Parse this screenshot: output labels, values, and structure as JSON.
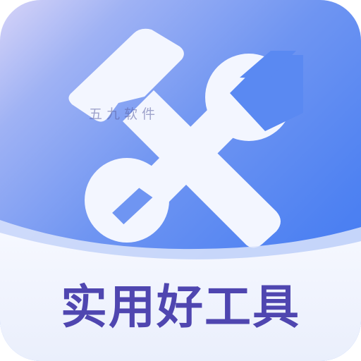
{
  "app_icon": {
    "title": "实用好工具",
    "watermark": "五九软件",
    "colors": {
      "gradient_start": "#d7d4f8",
      "gradient_end": "#3c76f0",
      "tool_fill": "#f3f6ff",
      "banner_fill": "#eef2fd",
      "title_color": "#4f46b0"
    },
    "icons": [
      "hammer-icon",
      "wrench-icon"
    ]
  }
}
